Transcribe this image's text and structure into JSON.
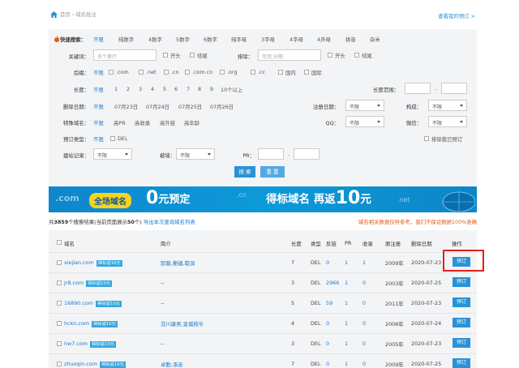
{
  "breadcrumb": {
    "home": "首页",
    "current": "域名抢注"
  },
  "header": {
    "my_booking": "查看我的预订 >"
  },
  "quick": {
    "label": "快速搜索：",
    "items": [
      "不限",
      "纯数字",
      "4数字",
      "5数字",
      "6数字",
      "纯字母",
      "3字母",
      "4字母",
      "4声母",
      "拼音",
      "杂米"
    ]
  },
  "keyword": {
    "label": "关键词：",
    "placeholder": "多个换行",
    "start": "开头",
    "end": "结尾"
  },
  "exclude": {
    "label": "排除：",
    "placeholder": "可用,分隔",
    "start": "开头",
    "end": "结尾"
  },
  "suffix": {
    "label": "后缀：",
    "items": [
      "不限",
      ".com",
      ".net",
      ".cn",
      ".com.cn",
      ".org",
      ".cc",
      "国内",
      "国际"
    ]
  },
  "length": {
    "label": "长度：",
    "items": [
      "不限",
      "1",
      "2",
      "3",
      "4",
      "5",
      "6",
      "7",
      "8",
      "9",
      "10个以上"
    ],
    "range_label": "长度范围：",
    "dash": "-"
  },
  "deldate": {
    "label": "删除日期：",
    "items": [
      "不限",
      "07月23日",
      "07月24日",
      "07月25日",
      "07月26日"
    ]
  },
  "regdate": {
    "label": "注册日期：",
    "value": "不限"
  },
  "compose": {
    "label": "构成：",
    "value": "不限"
  },
  "special": {
    "label": "特殊域名：",
    "items": [
      "不限",
      "高PR",
      "高收录",
      "高外链",
      "高年龄"
    ]
  },
  "qq": {
    "label": "QQ：",
    "value": "不限"
  },
  "wechat": {
    "label": "微信：",
    "value": "不限"
  },
  "booktype": {
    "label": "预订类型：",
    "items": [
      "不限",
      "DEL"
    ],
    "exclude_booked": "排除我已预订"
  },
  "history": {
    "label": "建站记录：",
    "value": "不限"
  },
  "wall": {
    "label": "被墙：",
    "value": "不限"
  },
  "pr": {
    "label": "PR：",
    "dash": "-"
  },
  "buttons": {
    "search": "搜 索",
    "reset": "重 置"
  },
  "banner": {
    "chip": "全场域名",
    "zero": "0",
    "yuan_pre": "元预定",
    "main": "得标域名 再返",
    "ten": "10",
    "yuan": "元",
    ".com": ".com",
    ".cn": ".cn",
    ".net": ".net"
  },
  "summary": {
    "pre": "共",
    "count": "3859",
    "mid": "个搜索结果(当前页面展示",
    "page": "50",
    "post": "个)",
    "export": "导出本次查询域名列表"
  },
  "notice": "域名相关数据仅供参考，我们不保证数据100%准确",
  "table": {
    "headers": [
      "域名",
      "简介",
      "长度",
      "类型",
      "反链",
      "PR",
      "收录",
      "原注册",
      "删除日期",
      "操作"
    ],
    "rows": [
      {
        "domain": "xiejian.com",
        "tag": "得标返10元",
        "intro": "卸腐,榭键,歇涧",
        "len": "7",
        "type": "DEL",
        "backlink": "0",
        "pr": "1",
        "index": "1",
        "reg": "2009年",
        "del": "2020-07-23",
        "op": "预订"
      },
      {
        "domain": "jr8.com",
        "tag": "得标返10元",
        "intro": "--",
        "len": "3",
        "type": "DEL",
        "backlink": "2966",
        "pr": "1",
        "index": "0",
        "reg": "2003年",
        "del": "2020-07-25",
        "op": "预订"
      },
      {
        "domain": "16890.com",
        "tag": "得标返10元",
        "intro": "--",
        "len": "5",
        "type": "DEL",
        "backlink": "59",
        "pr": "1",
        "index": "0",
        "reg": "2011年",
        "del": "2020-07-23",
        "op": "预订"
      },
      {
        "domain": "hckn.com",
        "tag": "得标返10元",
        "intro": "浩川康男,皇城核牛",
        "len": "4",
        "type": "DEL",
        "backlink": "0",
        "pr": "1",
        "index": "0",
        "reg": "2006年",
        "del": "2020-07-24",
        "op": "预订"
      },
      {
        "domain": "hw7.com",
        "tag": "得标返10元",
        "intro": "--",
        "len": "3",
        "type": "DEL",
        "backlink": "0",
        "pr": "1",
        "index": "0",
        "reg": "2005年",
        "del": "2020-07-23",
        "op": "预订"
      },
      {
        "domain": "zhuoqin.com",
        "tag": "得标返10元",
        "intro": "卓勤,涿亲",
        "len": "7",
        "type": "DEL",
        "backlink": "0",
        "pr": "1",
        "index": "0",
        "reg": "2009年",
        "del": "2020-07-25",
        "op": "预订"
      }
    ]
  },
  "colors": {
    "accent": "#1a7ad0",
    "button": "#2a92d6",
    "warn": "#e35c1c",
    "highlight": "#e02020"
  },
  "icons": [
    "home-icon",
    "fire-icon"
  ]
}
